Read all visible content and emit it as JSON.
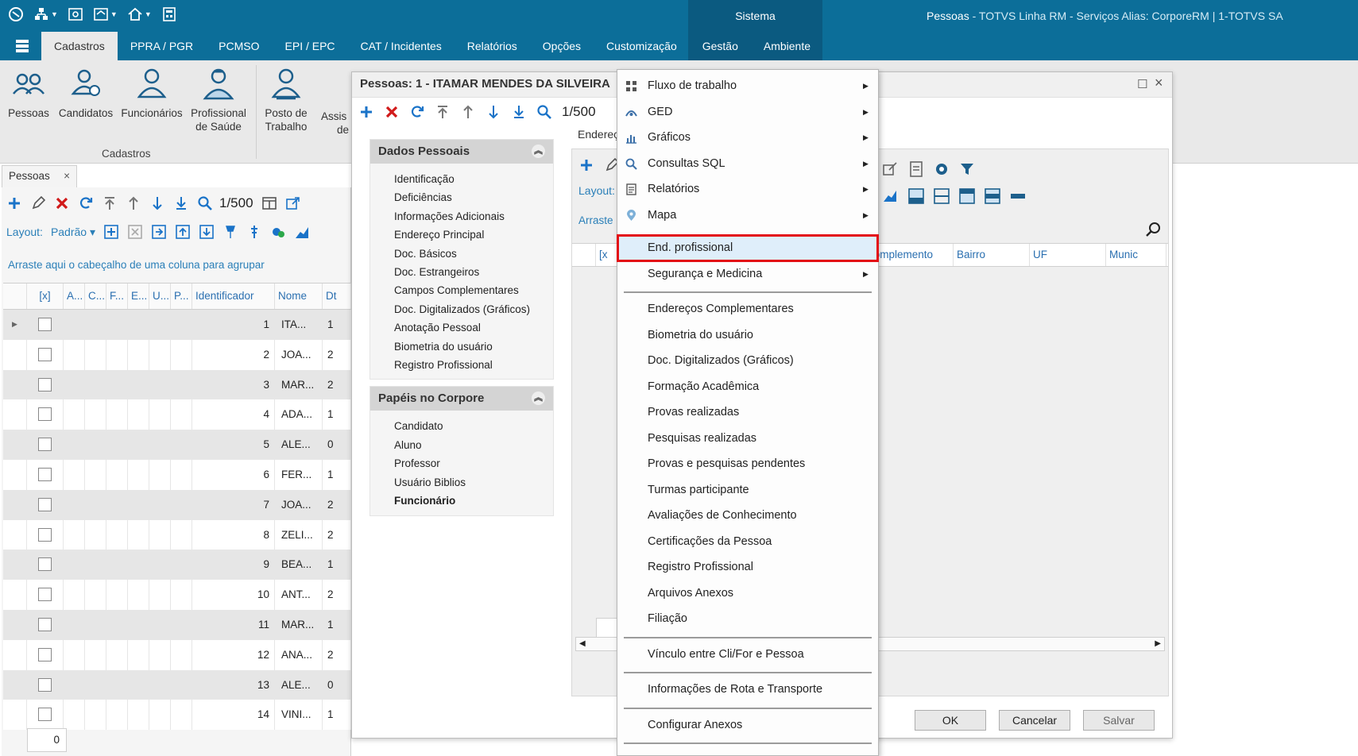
{
  "app": {
    "sistema_label": "Sistema",
    "title_main": "Pessoas",
    "title_rest": " - TOTVS Linha RM - Serviços  Alias: CorporeRM | 1-TOTVS SA"
  },
  "ribbon_tabs": [
    "Cadastros",
    "PPRA / PGR",
    "PCMSO",
    "EPI / EPC",
    "CAT / Incidentes",
    "Relatórios",
    "Opções",
    "Customização",
    "Gestão",
    "Ambiente"
  ],
  "ribbon": {
    "group_label": "Cadastros",
    "buttons": [
      {
        "line1": "Pessoas",
        "line2": ""
      },
      {
        "line1": "Candidatos",
        "line2": ""
      },
      {
        "line1": "Funcionários",
        "line2": ""
      },
      {
        "line1": "Profissional",
        "line2": "de Saúde"
      },
      {
        "line1": "Posto de",
        "line2": "Trabalho"
      },
      {
        "line1": "Assis",
        "line2": "de"
      }
    ]
  },
  "left": {
    "doc_tab": "Pessoas",
    "counter": "1/500",
    "layout_label": "Layout:",
    "layout_value": "Padrão",
    "group_hint": "Arraste aqui o cabeçalho de uma coluna para agrupar",
    "columns": [
      "[x]",
      "A...",
      "C...",
      "F...",
      "E...",
      "U...",
      "P...",
      "Identificador",
      "Nome",
      "Dt"
    ],
    "rows": [
      {
        "id": "1",
        "nome": "ITA...",
        "dt": "1"
      },
      {
        "id": "2",
        "nome": "JOA...",
        "dt": "2"
      },
      {
        "id": "3",
        "nome": "MAR...",
        "dt": "2"
      },
      {
        "id": "4",
        "nome": "ADA...",
        "dt": "1"
      },
      {
        "id": "5",
        "nome": "ALE...",
        "dt": "0"
      },
      {
        "id": "6",
        "nome": "FER...",
        "dt": "1"
      },
      {
        "id": "7",
        "nome": "JOA...",
        "dt": "2"
      },
      {
        "id": "8",
        "nome": "ZELI...",
        "dt": "2"
      },
      {
        "id": "9",
        "nome": "BEA...",
        "dt": "1"
      },
      {
        "id": "10",
        "nome": "ANT...",
        "dt": "2"
      },
      {
        "id": "11",
        "nome": "MAR...",
        "dt": "1"
      },
      {
        "id": "12",
        "nome": "ANA...",
        "dt": "2"
      },
      {
        "id": "13",
        "nome": "ALE...",
        "dt": "0"
      },
      {
        "id": "14",
        "nome": "VINI...",
        "dt": "1"
      }
    ],
    "footer_count": "0"
  },
  "dialog": {
    "title": "Pessoas: 1 - ITAMAR MENDES DA SILVEIRA",
    "counter": "1/500",
    "sections": [
      {
        "title": "Dados Pessoais",
        "items": [
          "Identificação",
          "Deficiências",
          "Informações Adicionais",
          "Endereço Principal",
          "Doc. Básicos",
          "Doc. Estrangeiros",
          "Campos Complementares",
          "Doc. Digitalizados (Gráficos)",
          "Anotação Pessoal",
          "Biometria do usuário",
          "Registro Profissional"
        ]
      },
      {
        "title": "Papéis no Corpore",
        "items": [
          "Candidato",
          "Aluno",
          "Professor",
          "Usuário Biblios",
          "Funcionário"
        ]
      }
    ],
    "content_tab": "Endereç",
    "content_layout": "Layout:",
    "content_arraste": "Arraste",
    "content_columns": [
      "[x",
      "Complemento",
      "Bairro",
      "UF",
      "Munic"
    ],
    "buttons": {
      "ok": "OK",
      "cancel": "Cancelar",
      "save": "Salvar"
    }
  },
  "menu": {
    "items_top": [
      {
        "label": "Fluxo de trabalho",
        "icon": "workflow-icon",
        "submenu": true
      },
      {
        "label": "GED",
        "icon": "ged-icon",
        "submenu": true
      },
      {
        "label": "Gráficos",
        "icon": "chart-icon",
        "submenu": true
      },
      {
        "label": "Consultas SQL",
        "icon": "search-icon",
        "submenu": true
      },
      {
        "label": "Relatórios",
        "icon": "report-icon",
        "submenu": true
      },
      {
        "label": "Mapa",
        "icon": "map-pin-icon",
        "submenu": true
      }
    ],
    "highlighted": "End. profissional",
    "seguranca": "Segurança e Medicina",
    "items_middle": [
      "Endereços Complementares",
      "Biometria do usuário",
      "Doc. Digitalizados (Gráficos)",
      "Formação Acadêmica",
      "Provas realizadas",
      "Pesquisas realizadas",
      "Provas e pesquisas pendentes",
      "Turmas participante",
      "Avaliações de Conhecimento",
      "Certificações da Pessoa",
      "Registro Profissional",
      "Arquivos Anexos",
      "Filiação"
    ],
    "vinculo": "Vínculo entre Cli/For e Pessoa",
    "rota": "Informações de Rota e Transporte",
    "anexos": "Configurar Anexos"
  },
  "colors": {
    "titlebar": "#0c6e99",
    "accent_blue": "#2a7fb8",
    "highlight_border": "#e30d14",
    "add_green": "#1a73c8",
    "delete_red": "#d11a1a"
  }
}
